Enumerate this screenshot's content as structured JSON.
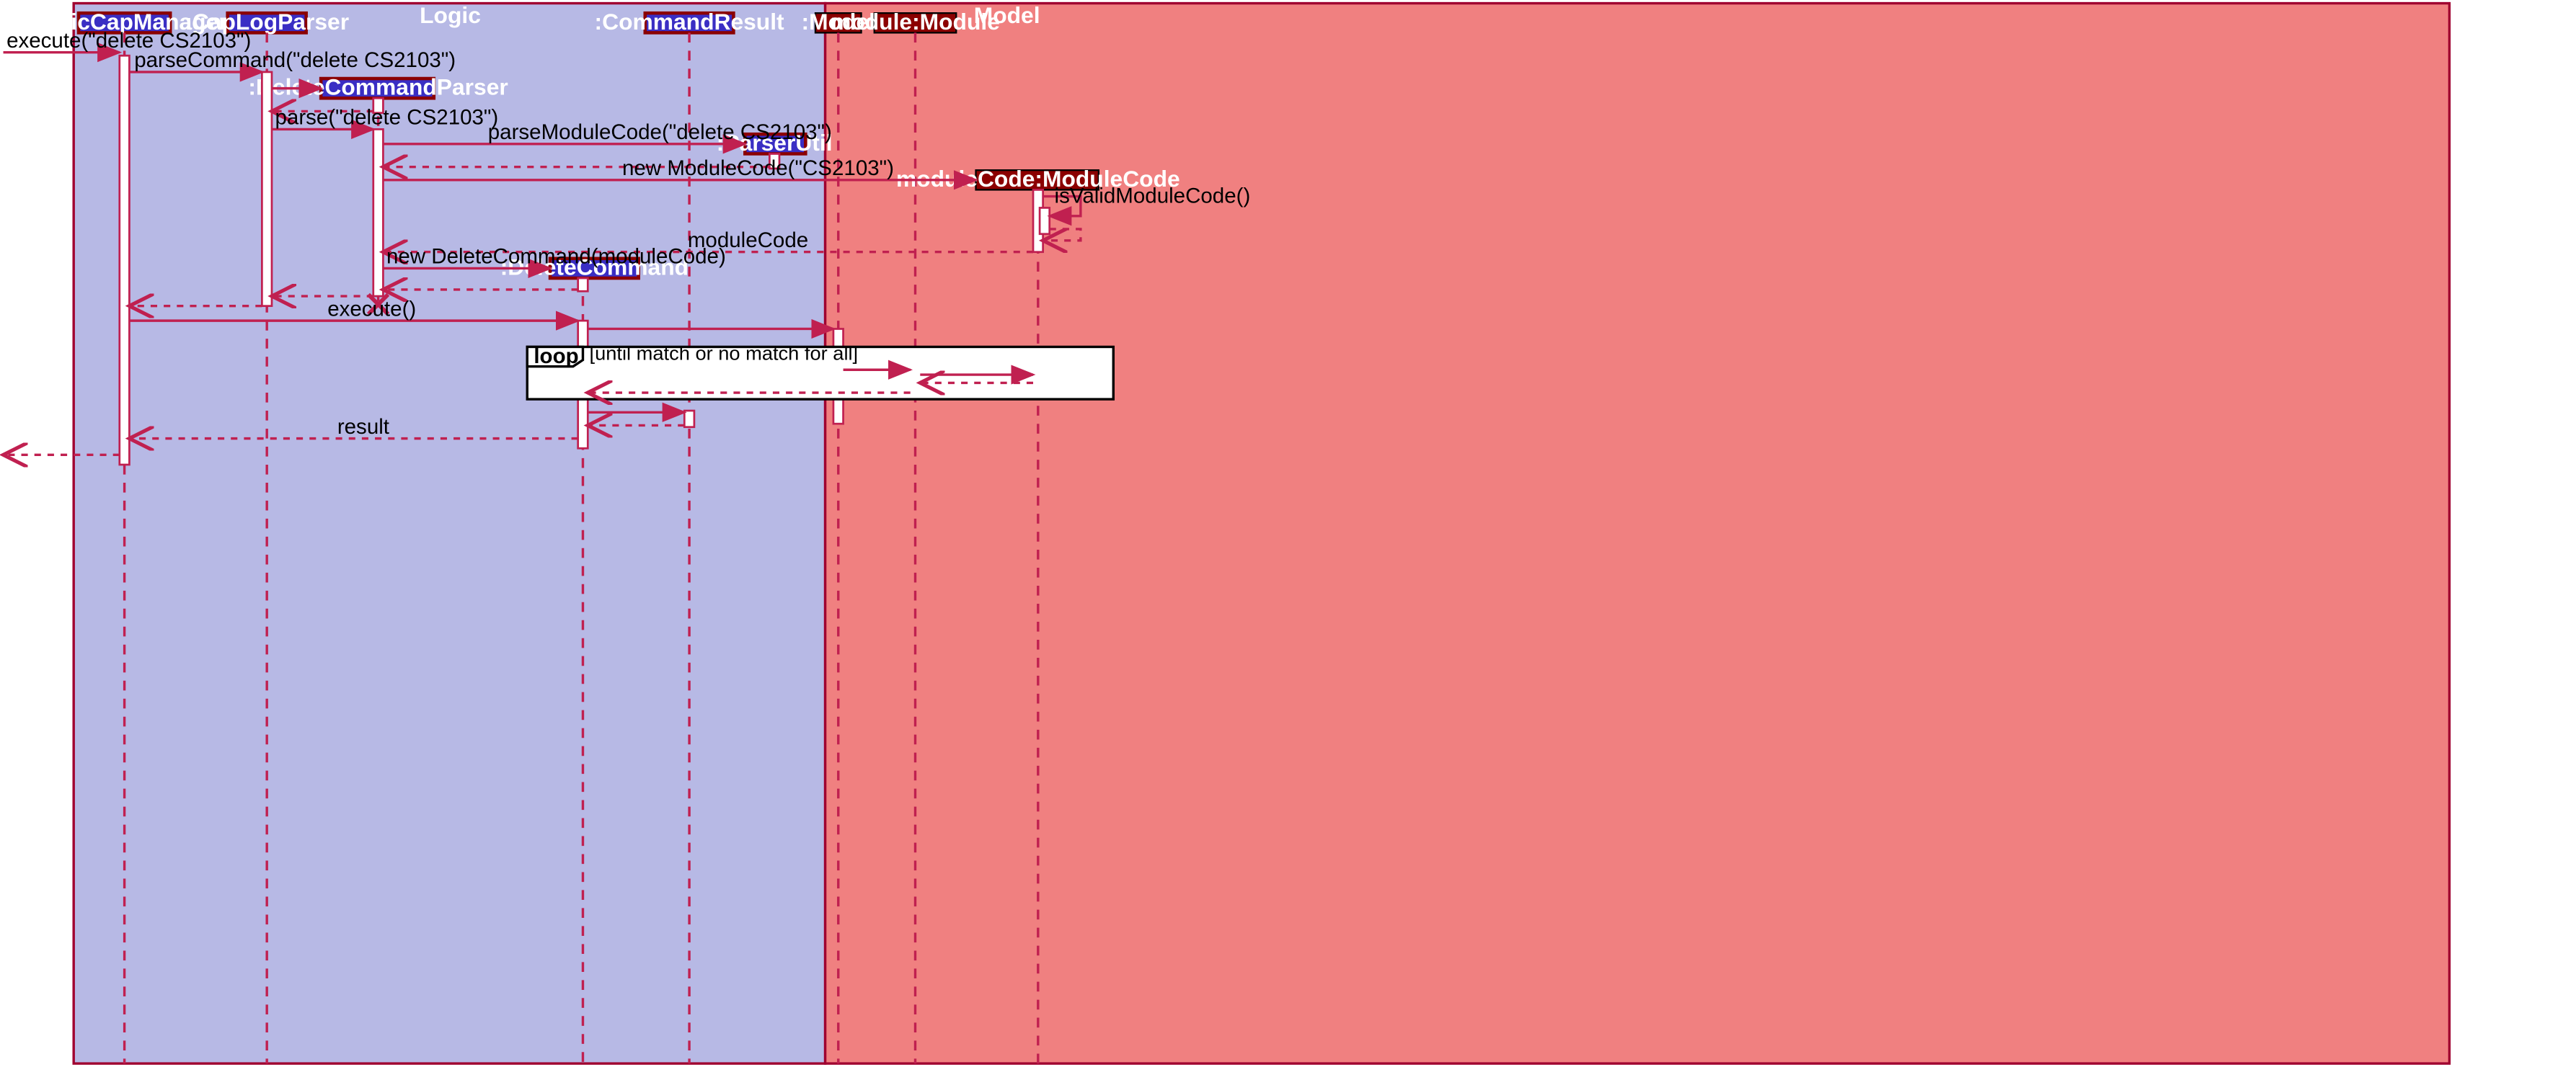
{
  "frames": {
    "logic": "Logic",
    "model": "Model"
  },
  "participants": {
    "logicCapManager": ":LogicCapManager",
    "capLogParser": ":CapLogParser",
    "deleteCommandParser": ":DeleteCommandParser",
    "deleteCommand": ":DeleteCommand",
    "commandResult": ":CommandResult",
    "parserUtil": ":ParserUtil",
    "model": ":Model",
    "module": "module:Module",
    "moduleCode": "moduleCode:ModuleCode"
  },
  "messages": {
    "execute1": "execute(\"delete CS2103\")",
    "parseCommand": "parseCommand(\"delete CS2103\")",
    "parse": "parse(\"delete CS2103\")",
    "parseModuleCode": "parseModuleCode(\"delete CS2103\")",
    "newModuleCode": "new ModuleCode(\"CS2103\")",
    "isValidModuleCode": "isValidModuleCode()",
    "moduleCodeReturn": "moduleCode",
    "newDeleteCommand": "new DeleteCommand(moduleCode)",
    "execute2": "execute()",
    "result": "result"
  },
  "fragments": {
    "loop": {
      "label": "loop",
      "guard": "[until match or no match for all]"
    }
  }
}
